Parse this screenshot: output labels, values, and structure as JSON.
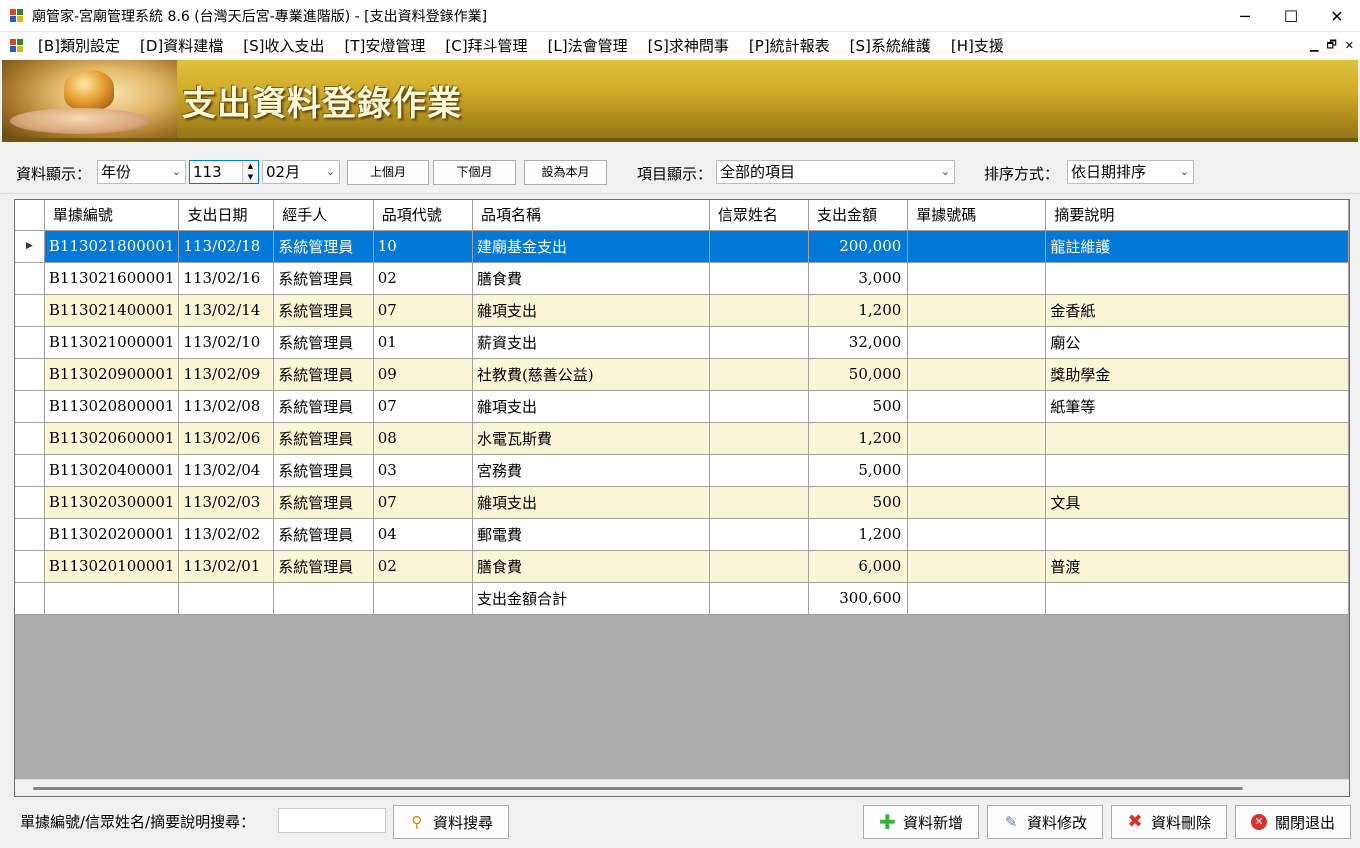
{
  "window": {
    "title": "廟管家-宮廟管理系統 8.6 (台灣天后宮-專業進階版) - [支出資料登錄作業]",
    "controls": [
      "─",
      "☐",
      "✕"
    ]
  },
  "menu": {
    "items": [
      "[B]類別設定",
      "[D]資料建檔",
      "[S]收入支出",
      "[T]安燈管理",
      "[C]拜斗管理",
      "[L]法會管理",
      "[S]求神問事",
      "[P]統計報表",
      "[S]系統維護",
      "[H]支援"
    ],
    "mdi_controls": [
      "▁",
      "🗗",
      "✕"
    ]
  },
  "banner": {
    "title": "支出資料登錄作業"
  },
  "filters": {
    "display_label": "資料顯示：",
    "year_mode": "年份",
    "year_value": "113",
    "month_value": "02月",
    "prev_month": "上個月",
    "next_month": "下個月",
    "this_month": "設為本月",
    "item_label": "項目顯示：",
    "item_value": "全部的項目",
    "sort_label": "排序方式：",
    "sort_value": "依日期排序"
  },
  "grid": {
    "columns": [
      "單據編號",
      "支出日期",
      "經手人",
      "品項代號",
      "品項名稱",
      "信眾姓名",
      "支出金額",
      "單據號碼",
      "摘要說明"
    ],
    "rows": [
      [
        "B113021800001",
        "113/02/18",
        "系統管理員",
        "10",
        "建廟基金支出",
        "",
        "200,000",
        "",
        "龍註維護"
      ],
      [
        "B113021600001",
        "113/02/16",
        "系統管理員",
        "02",
        "膳食費",
        "",
        "3,000",
        "",
        ""
      ],
      [
        "B113021400001",
        "113/02/14",
        "系統管理員",
        "07",
        "雜項支出",
        "",
        "1,200",
        "",
        "金香紙"
      ],
      [
        "B113021000001",
        "113/02/10",
        "系統管理員",
        "01",
        "薪資支出",
        "",
        "32,000",
        "",
        "廟公"
      ],
      [
        "B113020900001",
        "113/02/09",
        "系統管理員",
        "09",
        "社教費(慈善公益)",
        "",
        "50,000",
        "",
        "獎助學金"
      ],
      [
        "B113020800001",
        "113/02/08",
        "系統管理員",
        "07",
        "雜項支出",
        "",
        "500",
        "",
        "紙筆等"
      ],
      [
        "B113020600001",
        "113/02/06",
        "系統管理員",
        "08",
        "水電瓦斯費",
        "",
        "1,200",
        "",
        ""
      ],
      [
        "B113020400001",
        "113/02/04",
        "系統管理員",
        "03",
        "宮務費",
        "",
        "5,000",
        "",
        ""
      ],
      [
        "B113020300001",
        "113/02/03",
        "系統管理員",
        "07",
        "雜項支出",
        "",
        "500",
        "",
        "文具"
      ],
      [
        "B113020200001",
        "113/02/02",
        "系統管理員",
        "04",
        "郵電費",
        "",
        "1,200",
        "",
        ""
      ],
      [
        "B113020100001",
        "113/02/01",
        "系統管理員",
        "02",
        "膳食費",
        "",
        "6,000",
        "",
        "普渡"
      ]
    ],
    "total_label": "支出金額合計",
    "total_value": "300,600",
    "selected_row": 0
  },
  "bottom": {
    "search_label": "單據編號/信眾姓名/摘要說明搜尋：",
    "search_value": "",
    "search_button": "資料搜尋",
    "add_button": "資料新增",
    "edit_button": "資料修改",
    "delete_button": "資料刪除",
    "close_button": "關閉退出"
  },
  "colors": {
    "selected_row": "#0078d7",
    "alt_row": "#fbf6d6",
    "banner_gold": "#c9a32a",
    "add_icon": "#2db82d",
    "delete_icon": "#d9302c"
  }
}
